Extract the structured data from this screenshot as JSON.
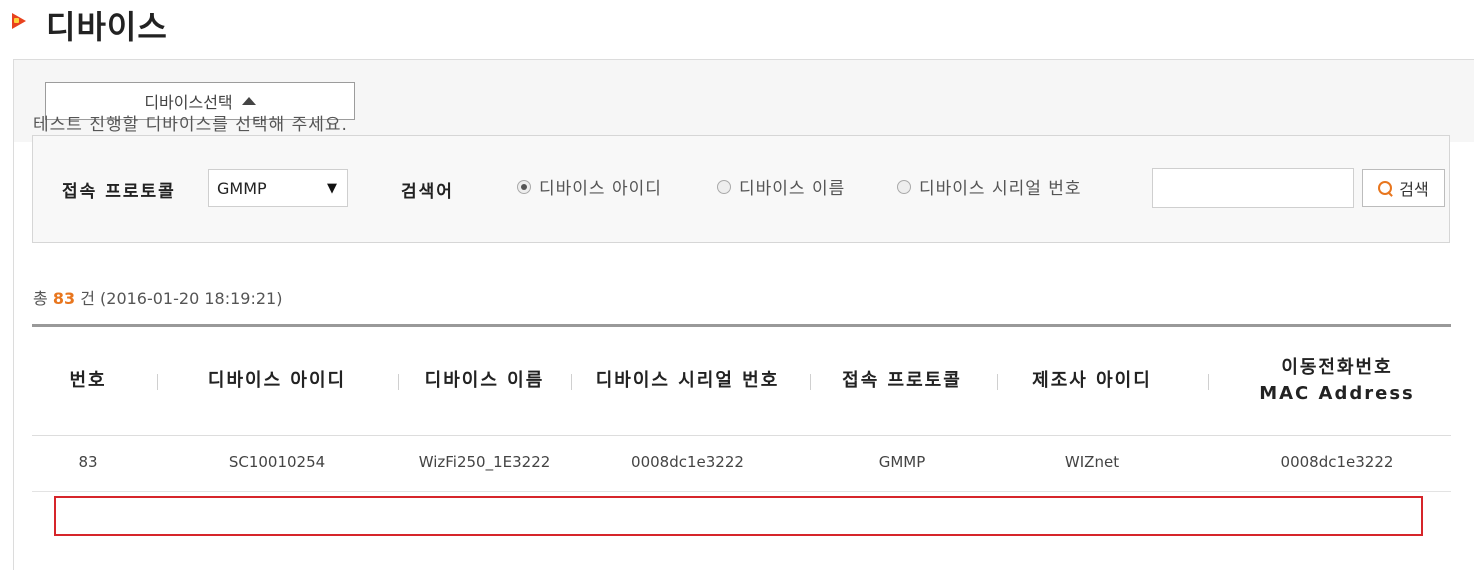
{
  "page": {
    "title": "디바이스"
  },
  "select_bar": {
    "button_label": "디바이스선택"
  },
  "instruction": "테스트 진행할 디바이스를 선택해 주세요.",
  "search": {
    "protocol_label": "접속 프로토콜",
    "protocol_value": "GMMP",
    "keyword_label": "검색어",
    "radio_options": [
      {
        "label": "디바이스 아이디",
        "selected": true
      },
      {
        "label": "디바이스 이름",
        "selected": false
      },
      {
        "label": "디바이스 시리얼 번호",
        "selected": false
      }
    ],
    "input_value": "",
    "button_label": "검색"
  },
  "summary": {
    "prefix": "총",
    "count": "83",
    "suffix": "건",
    "timestamp": "(2016-01-20 18:19:21)"
  },
  "table": {
    "headers": [
      [
        "번호"
      ],
      [
        "디바이스 아이디"
      ],
      [
        "디바이스 이름"
      ],
      [
        "디바이스 시리얼 번호"
      ],
      [
        "접속 프로토콜"
      ],
      [
        "제조사 아이디"
      ],
      [
        "이동전화번호",
        "MAC Address"
      ]
    ],
    "rows": [
      [
        "83",
        "SC10010254",
        "WizFi250_1E3222",
        "0008dc1e3222",
        "GMMP",
        "WIZnet",
        "0008dc1e3222"
      ]
    ]
  },
  "colors": {
    "accent": "#e8761e",
    "highlight": "#d6252a"
  }
}
